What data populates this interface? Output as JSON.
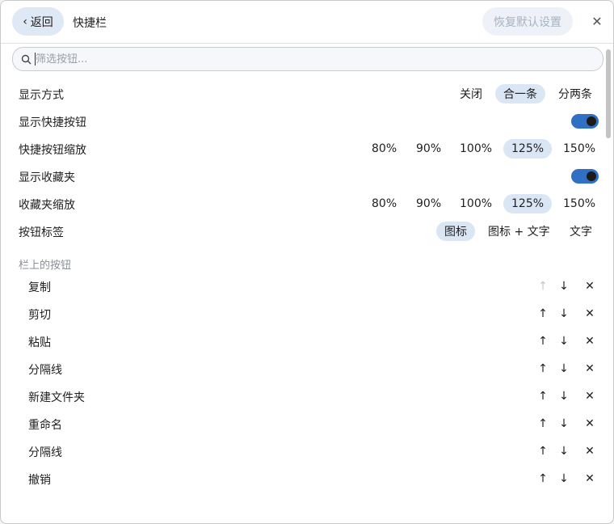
{
  "header": {
    "back_label": "返回",
    "title": "快捷栏",
    "reset_label": "恢复默认设置"
  },
  "search": {
    "placeholder": "筛选按钮..."
  },
  "settings": {
    "display_mode": {
      "label": "显示方式",
      "options": [
        "关闭",
        "合一条",
        "分两条"
      ],
      "selected": "合一条"
    },
    "show_quick_buttons": {
      "label": "显示快捷按钮",
      "enabled": true
    },
    "button_zoom": {
      "label": "快捷按钮缩放",
      "options": [
        "80%",
        "90%",
        "100%",
        "125%",
        "150%"
      ],
      "selected": "125%"
    },
    "show_favorites": {
      "label": "显示收藏夹",
      "enabled": true
    },
    "favorites_zoom": {
      "label": "收藏夹缩放",
      "options": [
        "80%",
        "90%",
        "100%",
        "125%",
        "150%"
      ],
      "selected": "125%"
    },
    "button_label": {
      "label": "按钮标签",
      "options": [
        "图标",
        "图标 + 文字",
        "文字"
      ],
      "selected": "图标"
    }
  },
  "bar_buttons": {
    "title": "栏上的按钮",
    "items": [
      "复制",
      "剪切",
      "粘贴",
      "分隔线",
      "新建文件夹",
      "重命名",
      "分隔线",
      "撤销"
    ],
    "up_glyph": "↑",
    "down_glyph": "↓",
    "remove_glyph": "✕"
  },
  "icons": {
    "back": "chevron-left-icon",
    "close": "close-icon",
    "search": "search-icon"
  },
  "colors": {
    "accent": "#2f6fc4",
    "selected_option_bg": "#dbe6f5",
    "back_button_bg": "#dfe8f5"
  }
}
